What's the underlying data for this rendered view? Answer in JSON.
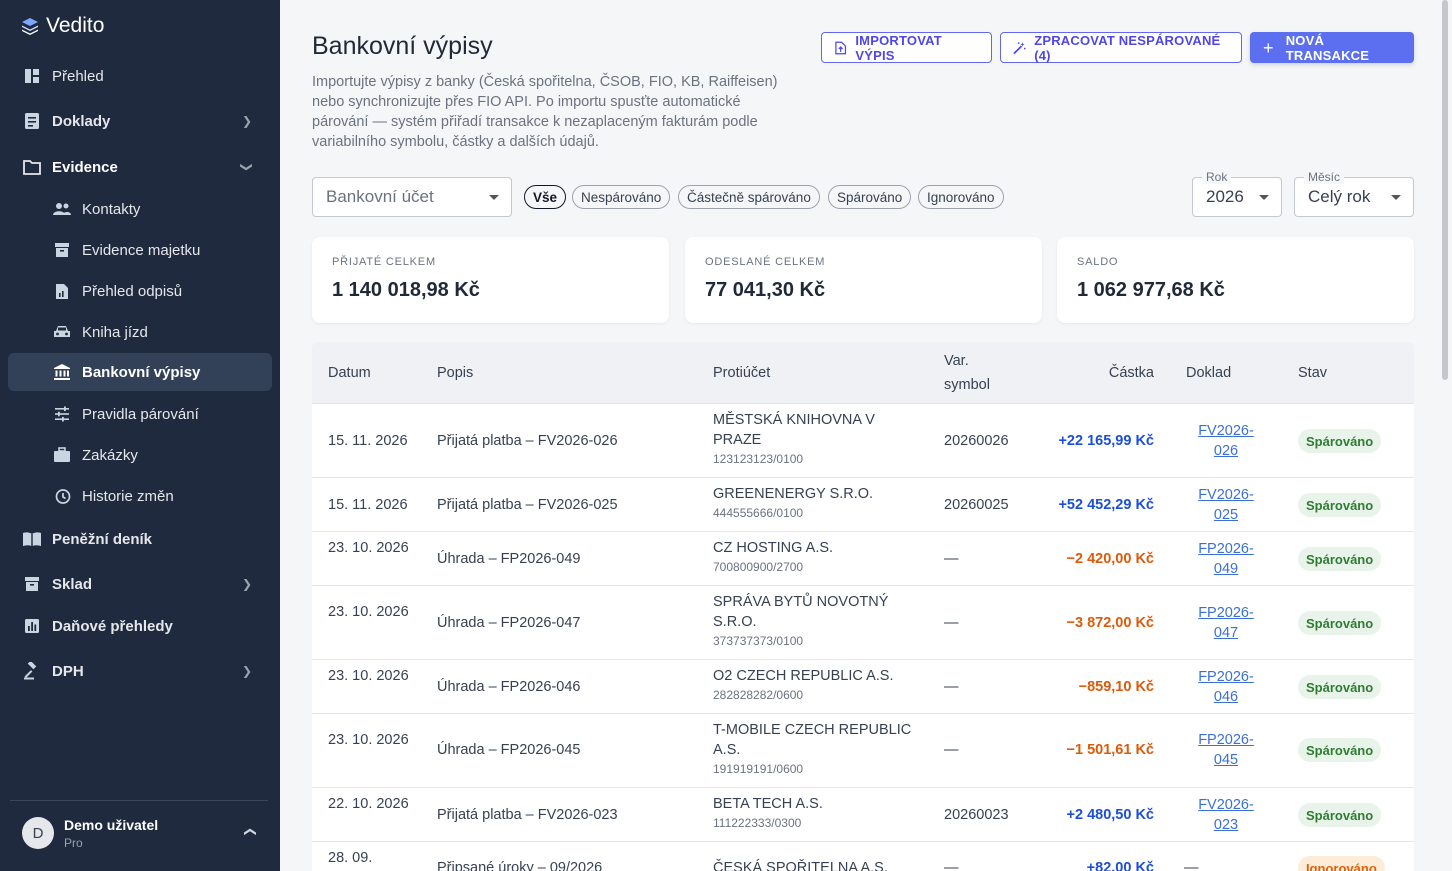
{
  "app": {
    "name": "Vedito"
  },
  "sidebar": {
    "items": [
      {
        "label": "Přehled"
      },
      {
        "label": "Doklady"
      },
      {
        "label": "Evidence"
      },
      {
        "label": "Kontakty"
      },
      {
        "label": "Evidence majetku"
      },
      {
        "label": "Přehled odpisů"
      },
      {
        "label": "Kniha jízd"
      },
      {
        "label": "Bankovní výpisy"
      },
      {
        "label": "Pravidla párování"
      },
      {
        "label": "Zakázky"
      },
      {
        "label": "Historie změn"
      },
      {
        "label": "Peněžní deník"
      },
      {
        "label": "Sklad"
      },
      {
        "label": "Daňové přehledy"
      },
      {
        "label": "DPH"
      }
    ],
    "user": {
      "initial": "D",
      "name": "Demo uživatel",
      "plan": "Pro"
    }
  },
  "header": {
    "title": "Bankovní výpisy",
    "description": "Importujte výpisy z banky (Česká spořitelna, ČSOB, FIO, KB, Raiffeisen) nebo synchronizujte přes FIO API. Po importu spusťte automatické párování — systém přiřadí transakce k nezaplaceným fakturám podle variabilního symbolu, částky a dalších údajů.",
    "buttons": {
      "import": "IMPORTOVAT VÝPIS",
      "process": "ZPRACOVAT NESPÁROVANÉ (4)",
      "new": "NOVÁ TRANSAKCE"
    }
  },
  "filters": {
    "account_placeholder": "Bankovní účet",
    "chips": [
      "Vše",
      "Nespárováno",
      "Částečně spárováno",
      "Spárováno",
      "Ignorováno"
    ],
    "year": {
      "label": "Rok",
      "value": "2026"
    },
    "month": {
      "label": "Měsíc",
      "value": "Celý rok"
    }
  },
  "summary": [
    {
      "label": "PŘIJATÉ CELKEM",
      "value": "1 140 018,98 Kč"
    },
    {
      "label": "ODESLANÉ CELKEM",
      "value": "77 041,30 Kč"
    },
    {
      "label": "SALDO",
      "value": "1 062 977,68 Kč"
    }
  ],
  "table": {
    "headers": {
      "date": "Datum",
      "desc": "Popis",
      "counterparty": "Protiúčet",
      "vs1": "Var.",
      "vs2": "symbol",
      "amount": "Částka",
      "doc": "Doklad",
      "status": "Stav"
    },
    "rows": [
      {
        "date": "15. 11. 2026",
        "desc": "Přijatá platba – FV2026-026",
        "cp": "MĚSTSKÁ KNIHOVNA V PRAZE",
        "acc": "123123123/0100",
        "vs": "20260026",
        "amount": "+22 165,99 Kč",
        "doc": "FV2026-026",
        "status": "Spárováno"
      },
      {
        "date": "15. 11. 2026",
        "desc": "Přijatá platba – FV2026-025",
        "cp": "GREENENERGY S.R.O.",
        "acc": "444555666/0100",
        "vs": "20260025",
        "amount": "+52 452,29 Kč",
        "doc": "FV2026-025",
        "status": "Spárováno"
      },
      {
        "date": "23. 10. 2026",
        "desc": "Úhrada – FP2026-049",
        "cp": "CZ HOSTING A.S.",
        "acc": "700800900/2700",
        "vs": "—",
        "amount": "−2 420,00 Kč",
        "doc": "FP2026-049",
        "status": "Spárováno"
      },
      {
        "date": "23. 10. 2026",
        "desc": "Úhrada – FP2026-047",
        "cp": "SPRÁVA BYTŮ NOVOTNÝ S.R.O.",
        "acc": "373737373/0100",
        "vs": "—",
        "amount": "−3 872,00 Kč",
        "doc": "FP2026-047",
        "status": "Spárováno"
      },
      {
        "date": "23. 10. 2026",
        "desc": "Úhrada – FP2026-046",
        "cp": "O2 CZECH REPUBLIC A.S.",
        "acc": "282828282/0600",
        "vs": "—",
        "amount": "−859,10 Kč",
        "doc": "FP2026-046",
        "status": "Spárováno"
      },
      {
        "date": "23. 10. 2026",
        "desc": "Úhrada – FP2026-045",
        "cp": "T-MOBILE CZECH REPUBLIC A.S.",
        "acc": "191919191/0600",
        "vs": "—",
        "amount": "−1 501,61 Kč",
        "doc": "FP2026-045",
        "status": "Spárováno"
      },
      {
        "date": "22. 10. 2026",
        "desc": "Přijatá platba – FV2026-023",
        "cp": "BETA TECH A.S.",
        "acc": "111222333/0300",
        "vs": "20260023",
        "amount": "+2 480,50 Kč",
        "doc": "FV2026-023",
        "status": "Spárováno"
      },
      {
        "date": "28. 09.",
        "desc": "Připsané úroky – 09/2026",
        "cp": "ČESKÁ SPOŘITELNA A.S.",
        "acc": "",
        "vs": "—",
        "amount": "+82,00 Kč",
        "doc": "—",
        "status": "Ignorováno"
      }
    ]
  }
}
